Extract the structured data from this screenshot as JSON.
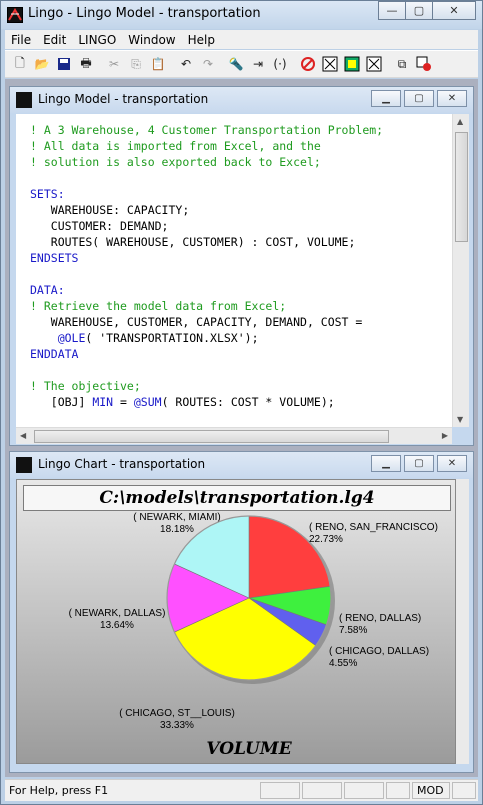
{
  "app": {
    "title": "Lingo - Lingo Model - transportation",
    "window_buttons": {
      "minimize": "—",
      "maximize": "▢",
      "close": "✕"
    }
  },
  "menu": [
    "File",
    "Edit",
    "LINGO",
    "Window",
    "Help"
  ],
  "toolbar": {
    "icons": [
      "new-icon",
      "open-icon",
      "save-icon",
      "print-icon",
      "cut-icon",
      "copy-icon",
      "paste-icon",
      "undo-icon",
      "redo-icon",
      "find-icon",
      "find-next-icon",
      "match-parenthesis-icon",
      "solve-icon",
      "stop-icon",
      "tile-icon",
      "close-window-icon",
      "cascade-icon",
      "close-all-icon"
    ]
  },
  "model_window": {
    "title": "Lingo Model - transportation",
    "code": [
      {
        "text": "! A 3 Warehouse, 4 Customer Transportation Problem;",
        "color": "green"
      },
      {
        "text": "! All data is imported from Excel, and the",
        "color": "green"
      },
      {
        "text": "! solution is also exported back to Excel;",
        "color": "green"
      },
      {
        "text": "",
        "color": "black"
      },
      {
        "text": "SETS:",
        "color": "blue"
      },
      {
        "text": "   WAREHOUSE: CAPACITY;",
        "color": "black"
      },
      {
        "text": "   CUSTOMER: DEMAND;",
        "color": "black"
      },
      {
        "text": "   ROUTES( WAREHOUSE, CUSTOMER) : COST, VOLUME;",
        "color": "black"
      },
      {
        "text": "ENDSETS",
        "color": "blue"
      },
      {
        "text": "",
        "color": "black"
      },
      {
        "text": "DATA:",
        "color": "blue"
      },
      {
        "text": "! Retrieve the model data from Excel;",
        "color": "green"
      },
      {
        "text": "   WAREHOUSE, CUSTOMER, CAPACITY, DEMAND, COST =",
        "color": "black"
      },
      {
        "text": "    @OLE( 'TRANSPORTATION.XLSX');",
        "color": "mixed-ole"
      },
      {
        "text": "ENDDATA",
        "color": "blue"
      },
      {
        "text": "",
        "color": "black"
      },
      {
        "text": "! The objective;",
        "color": "green"
      },
      {
        "text": "   [OBJ] MIN = @SUM( ROUTES: COST * VOLUME);",
        "color": "mixed-obj"
      }
    ]
  },
  "chart_window": {
    "title": "Lingo Chart - transportation",
    "chart_data": {
      "type": "pie",
      "title": "C:\\models\\transportation.lg4",
      "xlabel": "VOLUME",
      "categories": [
        "( RENO, SAN_FRANCISCO)",
        "( RENO, DALLAS)",
        "( CHICAGO, DALLAS)",
        "( CHICAGO, ST__LOUIS)",
        "( NEWARK, DALLAS)",
        "( NEWARK, MIAMI)"
      ],
      "values": [
        22.73,
        7.58,
        4.55,
        33.33,
        13.64,
        18.18
      ],
      "labels": [
        "22.73%",
        "7.58%",
        "4.55%",
        "33.33%",
        "13.64%",
        "18.18%"
      ],
      "colors": [
        "#ff3e3e",
        "#3ef03e",
        "#6060ee",
        "#ffff00",
        "#ff50ff",
        "#aef6f6"
      ]
    }
  },
  "status": {
    "help": "For Help, press F1",
    "mode": "MOD"
  }
}
